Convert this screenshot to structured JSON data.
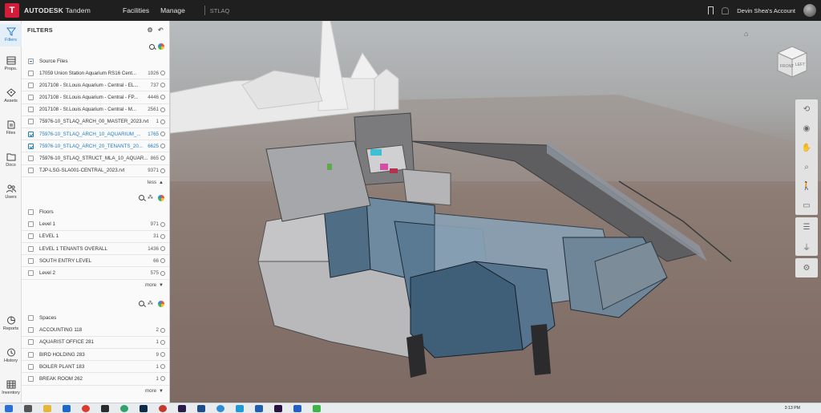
{
  "topbar": {
    "logo_letter": "T",
    "brand_bold": "AUTODESK",
    "brand_light": " Tandem",
    "nav": [
      "Facilities",
      "Manage"
    ],
    "facility": "STLAQ",
    "account": "Devin Shea's Account"
  },
  "rail": [
    {
      "label": "Filters",
      "icon": "filter-icon",
      "active": true
    },
    {
      "label": "Props.",
      "icon": "properties-icon"
    },
    {
      "label": "Assets",
      "icon": "assets-icon"
    },
    {
      "label": "Files",
      "icon": "files-icon"
    },
    {
      "label": "Docs",
      "icon": "docs-icon"
    },
    {
      "label": "Users",
      "icon": "users-icon"
    },
    {
      "label": "Reports",
      "icon": "reports-icon"
    },
    {
      "label": "History",
      "icon": "history-icon"
    },
    {
      "label": "Inventory",
      "icon": "inventory-icon"
    }
  ],
  "panel": {
    "title": "FILTERS",
    "source_files": {
      "label": "Source Files",
      "items": [
        {
          "name": "17059 Union Station Aquarium RS16 Cent...",
          "count": "1926",
          "checked": false
        },
        {
          "name": "2017108 - St.Louis Aquarium - Central - EL...",
          "count": "737",
          "checked": false
        },
        {
          "name": "2017108 - St.Louis Aquarium - Central - FP...",
          "count": "4446",
          "checked": false
        },
        {
          "name": "2017108 - St.Louis Aquarium - Central - M...",
          "count": "2561",
          "checked": false
        },
        {
          "name": "75976-10_STLAQ_ARCH_00_MASTER_2023.rvt",
          "count": "1",
          "checked": false
        },
        {
          "name": "75976-10_STLAQ_ARCH_10_AQUARIUM_...",
          "count": "1765",
          "checked": true
        },
        {
          "name": "75976-10_STLAQ_ARCH_20_TENANTS_20...",
          "count": "6625",
          "checked": true
        },
        {
          "name": "75976-10_STLAQ_STRUCT_MLA_10_AQUAR...",
          "count": "865",
          "checked": false
        },
        {
          "name": "TJP-LSG-SLA001-CENTRAL_2023.rvt",
          "count": "9371",
          "checked": false
        }
      ],
      "toggle": "less"
    },
    "floors": {
      "label": "Floors",
      "items": [
        {
          "name": "Level 1",
          "count": "971"
        },
        {
          "name": "LEVEL 1",
          "count": "31"
        },
        {
          "name": "LEVEL 1 TENANTS OVERALL",
          "count": "1436"
        },
        {
          "name": "SOUTH ENTRY LEVEL",
          "count": "66"
        },
        {
          "name": "Level 2",
          "count": "575"
        }
      ],
      "toggle": "more"
    },
    "spaces": {
      "label": "Spaces",
      "items": [
        {
          "name": "ACCOUNTING 118",
          "count": "2"
        },
        {
          "name": "AQUARIST OFFICE 281",
          "count": "1"
        },
        {
          "name": "BIRD HOLDING 283",
          "count": "9"
        },
        {
          "name": "BOILER PLANT 183",
          "count": "1"
        },
        {
          "name": "BREAK ROOM 262",
          "count": "1"
        }
      ],
      "toggle": "more"
    }
  },
  "viewcube": {
    "face_front": "FRONT",
    "face_left": "LEFT"
  },
  "taskbar": {
    "time": "3:13 PM",
    "colors": {
      "accent": "#1f7ac1",
      "brand": "#d21d3a"
    }
  }
}
